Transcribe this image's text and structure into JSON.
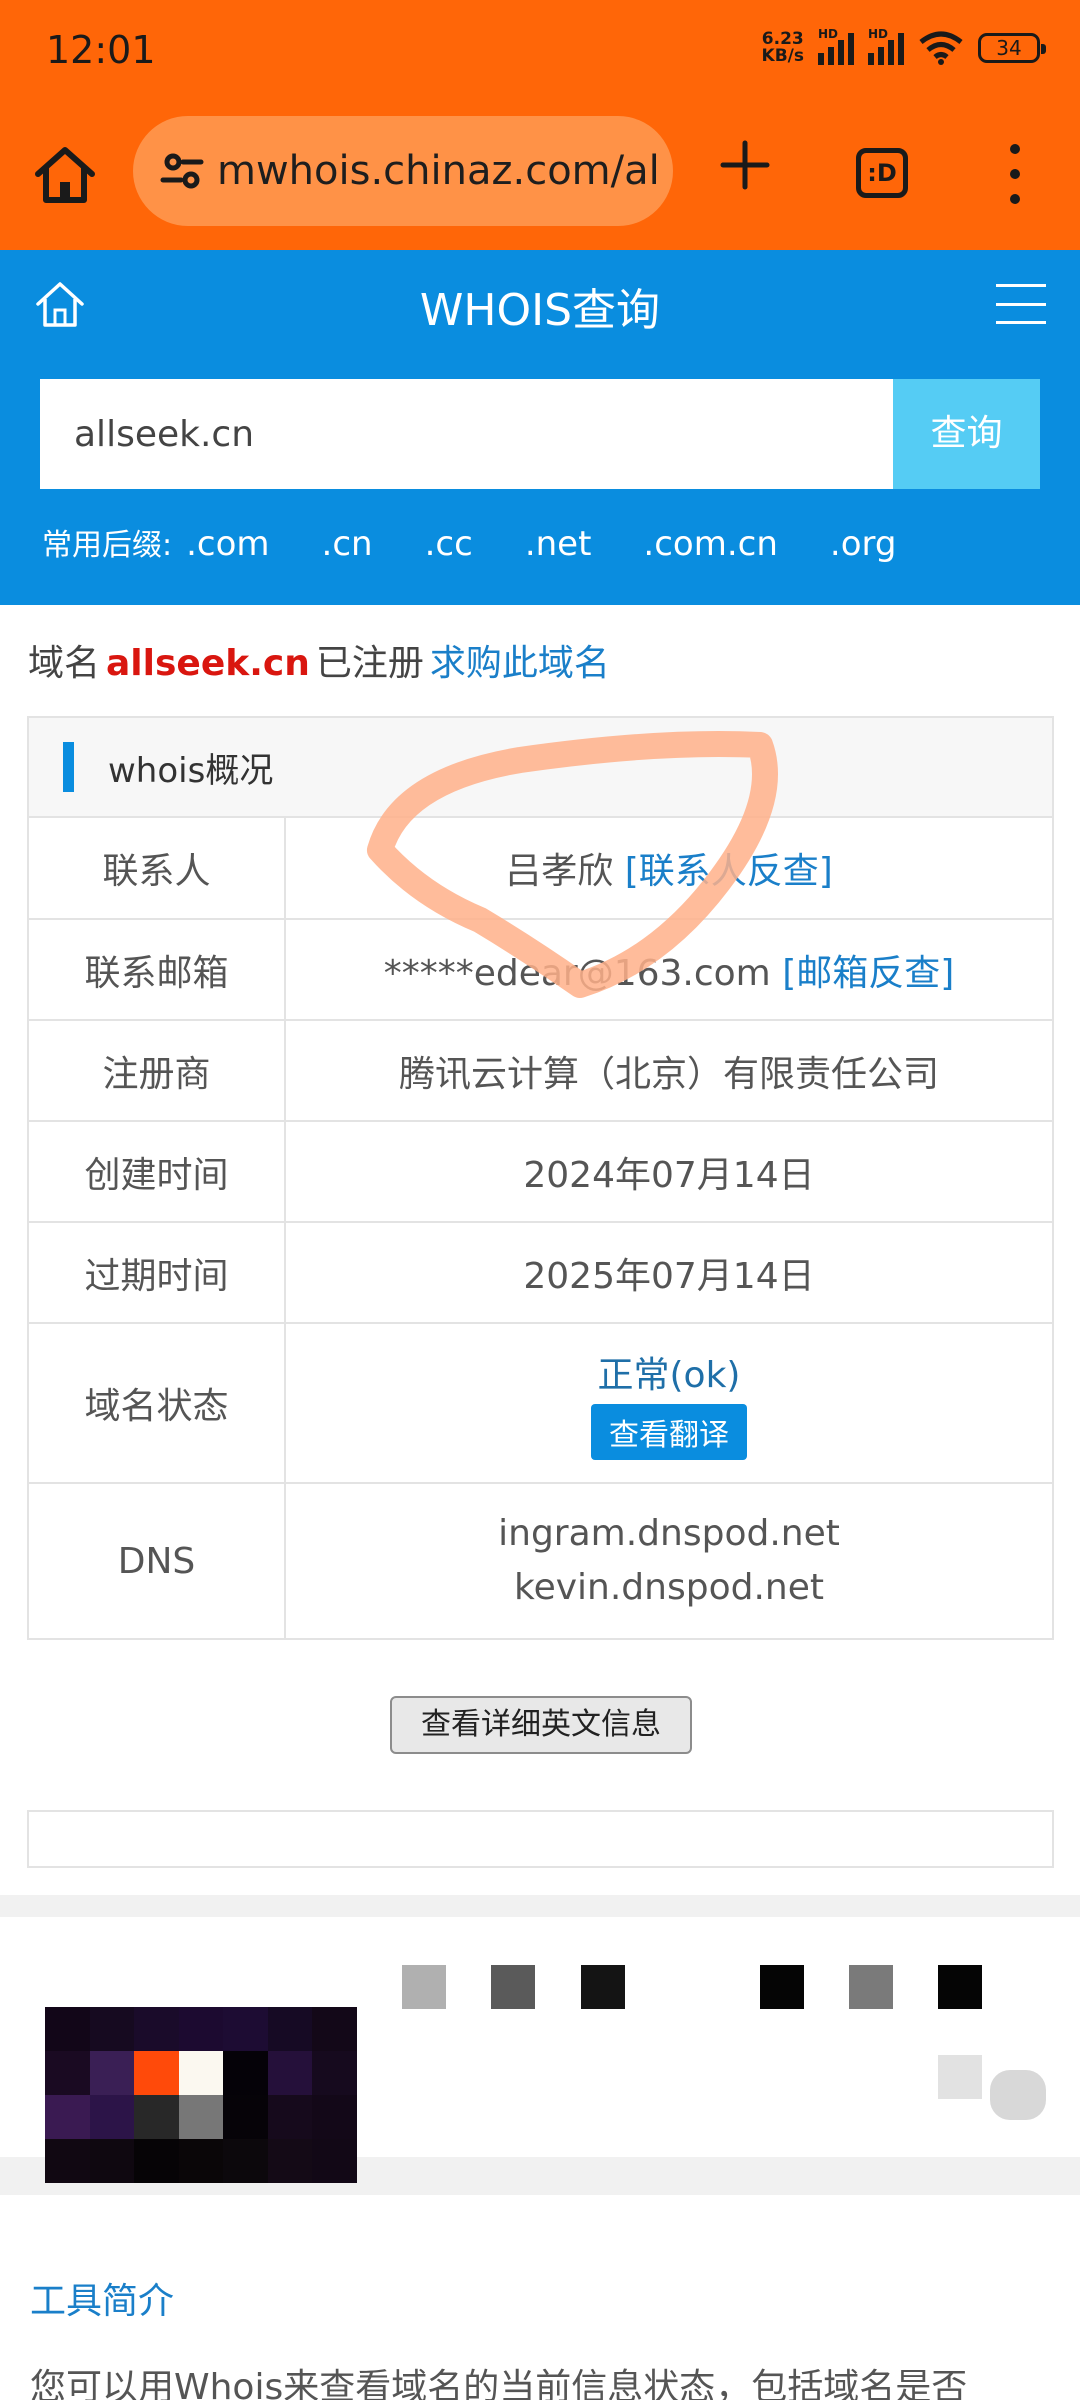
{
  "status_bar": {
    "time": "12:01",
    "net_speed_value": "6.23",
    "net_speed_unit": "KB/s",
    "hd_label": "HD",
    "battery": "34"
  },
  "browser": {
    "url": "mwhois.chinaz.com/al",
    "tabs_label": ":D",
    "icons": [
      "home-icon",
      "site-settings-icon",
      "plus-icon",
      "tabs-icon",
      "more-vert-icon"
    ]
  },
  "site": {
    "title": "WHOIS查询",
    "search_value": "allseek.cn",
    "search_button": "查询",
    "suffix_label": "常用后缀:",
    "suffixes": [
      ".com",
      ".cn",
      ".cc",
      ".net",
      ".com.cn",
      ".org"
    ],
    "accent_color": "#0a8ddf"
  },
  "domain_status": {
    "prefix": "域名",
    "domain": "allseek.cn",
    "registered": "已注册",
    "buy_link": "求购此域名"
  },
  "whois": {
    "title": "whois概况",
    "rows": [
      {
        "key": "联系人",
        "value": "吕孝欣",
        "link": "[联系人反查]"
      },
      {
        "key": "联系邮箱",
        "value": "*****edear@163.com",
        "link": "[邮箱反查]"
      },
      {
        "key": "注册商",
        "value": "腾讯云计算（北京）有限责任公司"
      },
      {
        "key": "创建时间",
        "value": "2024年07月14日"
      },
      {
        "key": "过期时间",
        "value": "2025年07月14日"
      }
    ],
    "status": {
      "key": "域名状态",
      "value": "正常(ok)",
      "button": "查看翻译"
    },
    "dns": {
      "key": "DNS",
      "servers": [
        "ingram.dnspod.net",
        "kevin.dnspod.net"
      ]
    }
  },
  "detail_button": "查看详细英文信息",
  "intro": {
    "title": "工具简介",
    "text": "您可以用Whois来查看域名的当前信息状态，包括域名是否"
  }
}
